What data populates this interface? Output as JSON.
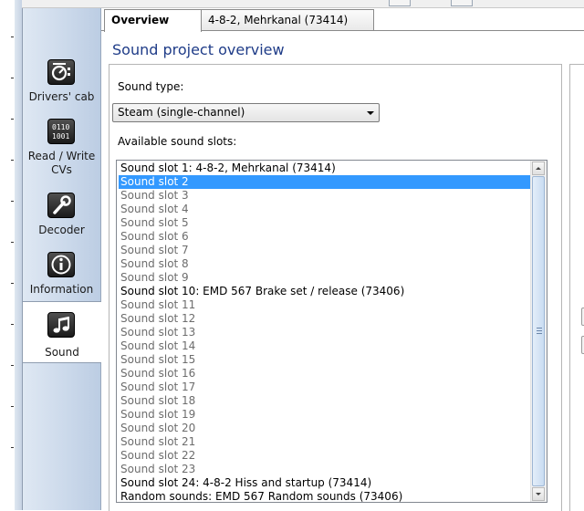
{
  "sidebar": {
    "items": [
      {
        "label": "Drivers' cab",
        "icon": "drivers-cab-icon"
      },
      {
        "label": "Read / Write CVs",
        "icon": "read-write-cvs-icon"
      },
      {
        "label": "Decoder",
        "icon": "decoder-wrench-icon"
      },
      {
        "label": "Information",
        "icon": "information-icon"
      },
      {
        "label": "Sound",
        "icon": "sound-note-icon",
        "active": true
      }
    ]
  },
  "tabs": [
    {
      "label": "Overview",
      "active": true
    },
    {
      "label": "4-8-2, Mehrkanal (73414)"
    }
  ],
  "main": {
    "title": "Sound project overview",
    "sound_type_label": "Sound type:",
    "sound_type_value": "Steam (single-channel)",
    "slots_label": "Available sound slots:",
    "slots": [
      {
        "text": "Sound slot 1: 4-8-2, Mehrkanal (73414)",
        "filled": true
      },
      {
        "text": "Sound slot 2",
        "filled": false,
        "selected": true
      },
      {
        "text": "Sound slot 3",
        "filled": false
      },
      {
        "text": "Sound slot 4",
        "filled": false
      },
      {
        "text": "Sound slot 5",
        "filled": false
      },
      {
        "text": "Sound slot 6",
        "filled": false
      },
      {
        "text": "Sound slot 7",
        "filled": false
      },
      {
        "text": "Sound slot 8",
        "filled": false
      },
      {
        "text": "Sound slot 9",
        "filled": false
      },
      {
        "text": "Sound slot 10: EMD 567 Brake set / release (73406)",
        "filled": true
      },
      {
        "text": "Sound slot 11",
        "filled": false
      },
      {
        "text": "Sound slot 12",
        "filled": false
      },
      {
        "text": "Sound slot 13",
        "filled": false
      },
      {
        "text": "Sound slot 14",
        "filled": false
      },
      {
        "text": "Sound slot 15",
        "filled": false
      },
      {
        "text": "Sound slot 16",
        "filled": false
      },
      {
        "text": "Sound slot 17",
        "filled": false
      },
      {
        "text": "Sound slot 18",
        "filled": false
      },
      {
        "text": "Sound slot 19",
        "filled": false
      },
      {
        "text": "Sound slot 20",
        "filled": false
      },
      {
        "text": "Sound slot 21",
        "filled": false
      },
      {
        "text": "Sound slot 22",
        "filled": false
      },
      {
        "text": "Sound slot 23",
        "filled": false
      },
      {
        "text": "Sound slot 24: 4-8-2 Hiss and startup (73414)",
        "filled": true
      },
      {
        "text": "Random sounds: EMD 567 Random sounds (73406)",
        "filled": true
      }
    ]
  },
  "colors": {
    "title": "#1f3c88",
    "selection": "#3399ff",
    "empty_slot_text": "#6d6d6d"
  }
}
